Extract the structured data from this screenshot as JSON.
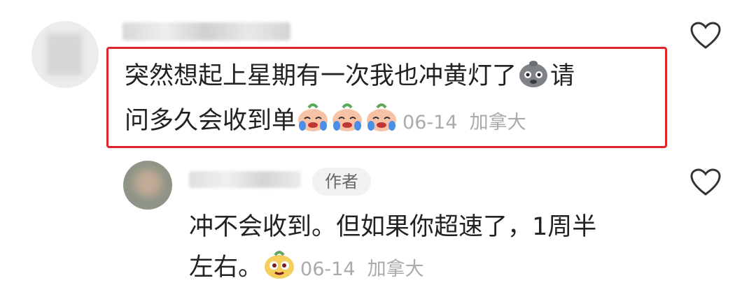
{
  "comments": [
    {
      "text": "突然想起上星期有一次我也冲黄灯了",
      "text2": "请问多久会收到单",
      "date": "06-14",
      "location": "加拿大"
    },
    {
      "author_badge": "作者",
      "text": "冲不会收到。但如果你超速了，1周半",
      "text2": "左右。",
      "date": "06-14",
      "location": "加拿大"
    }
  ],
  "colors": {
    "highlight": "#e0252b",
    "meta": "#aaaaaa",
    "text": "#222222"
  },
  "icons": [
    "heart-outline-icon",
    "sob-emoji-icon",
    "crying-emoji-icon",
    "smirk-emoji-icon"
  ]
}
